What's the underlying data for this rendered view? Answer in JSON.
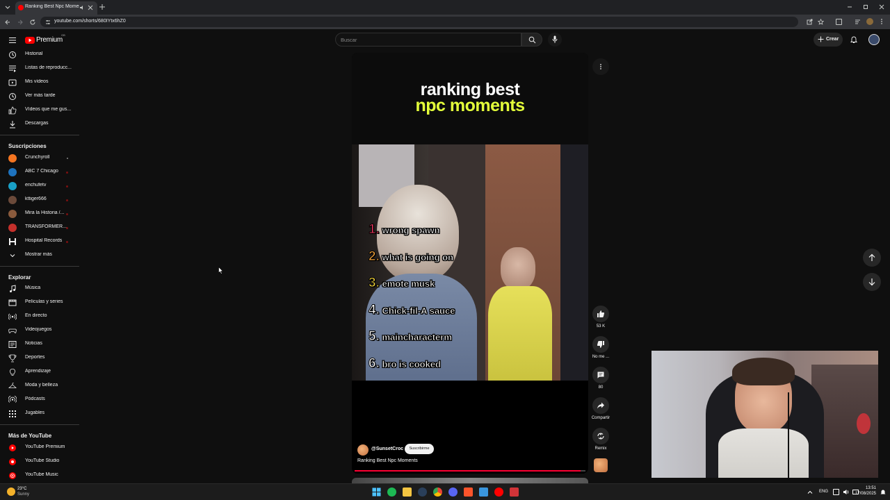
{
  "browser": {
    "tab_title": "Ranking Best Npc Moments",
    "url": "youtube.com/shorts/680IYtx6hZ0"
  },
  "header": {
    "logo_text": "Premium",
    "logo_sup": "GB",
    "search_placeholder": "Buscar",
    "create_label": "Crear"
  },
  "sidebar": {
    "you_items": [
      {
        "label": "Historial",
        "icon": "history-icon"
      },
      {
        "label": "Listas de reproducc...",
        "icon": "playlist-icon"
      },
      {
        "label": "Mis vídeos",
        "icon": "video-icon"
      },
      {
        "label": "Ver más tarde",
        "icon": "clock-icon"
      },
      {
        "label": "Vídeos que me gus...",
        "icon": "thumb-up-icon"
      },
      {
        "label": "Descargas",
        "icon": "download-icon"
      }
    ],
    "subs_title": "Suscripciones",
    "subs": [
      {
        "label": "Crunchyroll",
        "color": "#f47521"
      },
      {
        "label": "ABC 7 Chicago",
        "color": "#1e73be"
      },
      {
        "label": "enchufetv",
        "color": "#19a0c6"
      },
      {
        "label": "kttiger666",
        "color": "#6b4a3a"
      },
      {
        "label": "Mira la Historia /...",
        "color": "#8a5a3c"
      },
      {
        "label": "TRANSFORMER...",
        "color": "#c4302b"
      },
      {
        "label": "Hospital Records",
        "color": "#ffffff"
      }
    ],
    "show_more": "Mostrar más",
    "explore_title": "Explorar",
    "explore": [
      {
        "label": "Música",
        "icon": "music-icon"
      },
      {
        "label": "Películas y series",
        "icon": "film-icon"
      },
      {
        "label": "En directo",
        "icon": "live-icon"
      },
      {
        "label": "Videojuegos",
        "icon": "gamepad-icon"
      },
      {
        "label": "Noticias",
        "icon": "news-icon"
      },
      {
        "label": "Deportes",
        "icon": "trophy-icon"
      },
      {
        "label": "Aprendizaje",
        "icon": "bulb-icon"
      },
      {
        "label": "Moda y belleza",
        "icon": "hanger-icon"
      },
      {
        "label": "Pódcasts",
        "icon": "podcast-icon"
      },
      {
        "label": "Jugables",
        "icon": "grid-icon"
      }
    ],
    "more_title": "Más de YouTube",
    "more": [
      {
        "label": "YouTube Premium"
      },
      {
        "label": "YouTube Studio"
      },
      {
        "label": "YouTube Music"
      }
    ]
  },
  "short": {
    "title_line1": "ranking best",
    "title_line2": "npc moments",
    "rank_list": [
      {
        "num": "1.",
        "text": "wrong spawn",
        "color": "#e2345a"
      },
      {
        "num": "2.",
        "text": "what is going on",
        "color": "#f0a13a"
      },
      {
        "num": "3.",
        "text": "emote musk",
        "color": "#f0d23a"
      },
      {
        "num": "4.",
        "text": "Chick-fil-A sauce",
        "color": "#ffffff"
      },
      {
        "num": "5.",
        "text": "maincharacterm",
        "color": "#ffffff"
      },
      {
        "num": "6.",
        "text": "bro is cooked",
        "color": "#ffffff"
      }
    ],
    "channel": "@SunsetCroc",
    "subscribe": "Suscribirme",
    "video_title": "Ranking Best Npc Moments",
    "progress": 0.98
  },
  "actions": {
    "likes": "53 K",
    "dislike": "No me ...",
    "comments": "80",
    "share": "Compartir",
    "remix": "Remix"
  },
  "taskbar": {
    "weather_temp": "23°C",
    "weather_desc": "Sunny",
    "lang": "ENG",
    "time": "13:51",
    "date": "17/08/2025"
  }
}
